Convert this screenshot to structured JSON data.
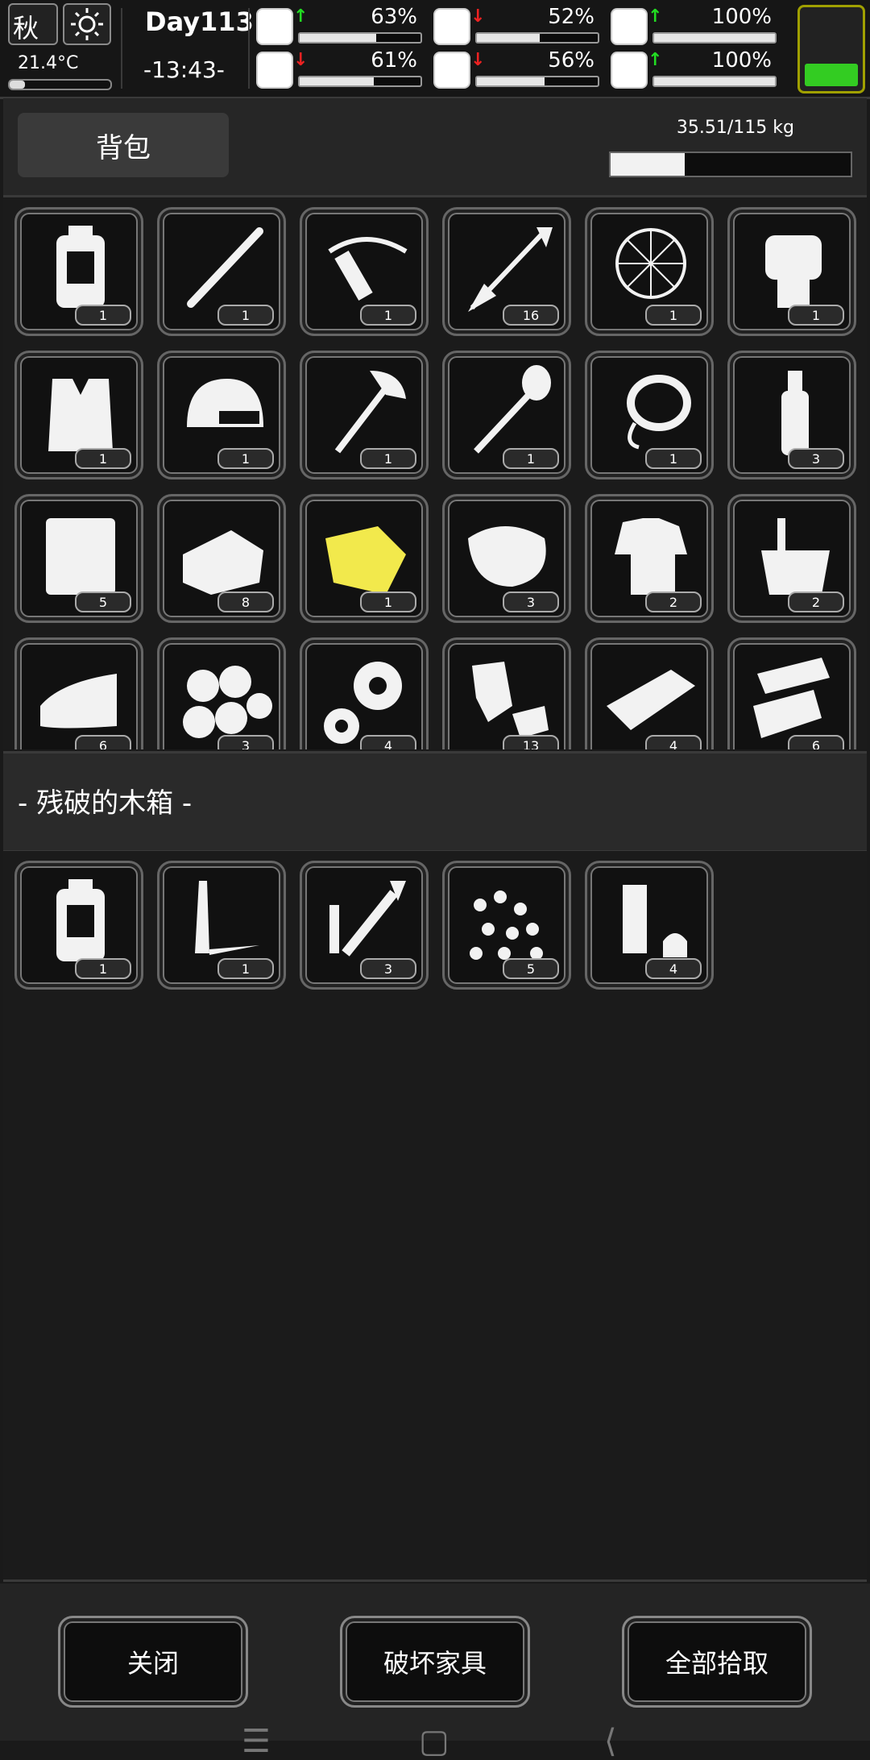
{
  "status": {
    "season": "秋",
    "temperature": "21.4°C",
    "temperature_level": 0.15,
    "day": "Day113",
    "time": "-13:43-",
    "stats": [
      {
        "name": "health",
        "icon": "medkit-icon",
        "trend": "up",
        "value": "63%",
        "level": 0.63
      },
      {
        "name": "hunger",
        "icon": "stomach-icon",
        "trend": "down",
        "value": "52%",
        "level": 0.52
      },
      {
        "name": "medicine",
        "icon": "pill-icon",
        "trend": "up",
        "value": "100%",
        "level": 1.0
      },
      {
        "name": "stamina",
        "icon": "boot-icon",
        "trend": "down",
        "value": "61%",
        "level": 0.61
      },
      {
        "name": "thirst",
        "icon": "water-drop-icon",
        "trend": "down",
        "value": "56%",
        "level": 0.56
      },
      {
        "name": "mood",
        "icon": "heart-icon",
        "trend": "up",
        "value": "100%",
        "level": 1.0
      }
    ],
    "colors": {
      "up": "#22dd22",
      "down": "#ee2222",
      "battery": "#33cc22"
    }
  },
  "bag": {
    "tab_label": "背包",
    "weight": "35.51/115 kg",
    "weight_level": 0.31,
    "items": [
      {
        "icon": "backpack-icon",
        "count": "1"
      },
      {
        "icon": "knife-icon",
        "count": "1"
      },
      {
        "icon": "crossbow-icon",
        "count": "1"
      },
      {
        "icon": "arrow-icon",
        "count": "16"
      },
      {
        "icon": "net-icon",
        "count": "1"
      },
      {
        "icon": "glove-icon",
        "count": "1"
      },
      {
        "icon": "vest-icon",
        "count": "1"
      },
      {
        "icon": "helmet-icon",
        "count": "1"
      },
      {
        "icon": "axe-icon",
        "count": "1"
      },
      {
        "icon": "shovel-icon",
        "count": "1"
      },
      {
        "icon": "rope-icon",
        "count": "1"
      },
      {
        "icon": "bottle-icon",
        "count": "3"
      },
      {
        "icon": "cloth-icon",
        "count": "5"
      },
      {
        "icon": "rag-icon",
        "count": "8"
      },
      {
        "icon": "yellow-cloth-icon",
        "count": "1"
      },
      {
        "icon": "meat-icon",
        "count": "3"
      },
      {
        "icon": "shirt-icon",
        "count": "2"
      },
      {
        "icon": "bucket-icon",
        "count": "2"
      },
      {
        "icon": "towel-icon",
        "count": "6"
      },
      {
        "icon": "cotton-icon",
        "count": "3"
      },
      {
        "icon": "gear-icon",
        "count": "4"
      },
      {
        "icon": "scrap-metal-icon",
        "count": "13"
      },
      {
        "icon": "wood-plank-icon",
        "count": "4"
      },
      {
        "icon": "metal-sheet-icon",
        "count": "6"
      }
    ]
  },
  "box": {
    "title": "- 残破的木箱 -",
    "items": [
      {
        "icon": "backpack-icon",
        "count": "1"
      },
      {
        "icon": "spike-icon",
        "count": "1"
      },
      {
        "icon": "tool-parts-icon",
        "count": "3"
      },
      {
        "icon": "pellets-icon",
        "count": "5"
      },
      {
        "icon": "cartridge-icon",
        "count": "4"
      }
    ]
  },
  "buttons": {
    "close": "关闭",
    "destroy": "破坏家具",
    "pickup_all": "全部拾取"
  },
  "nav": {
    "menu": "☰",
    "home": "▢",
    "back": "⟨"
  }
}
